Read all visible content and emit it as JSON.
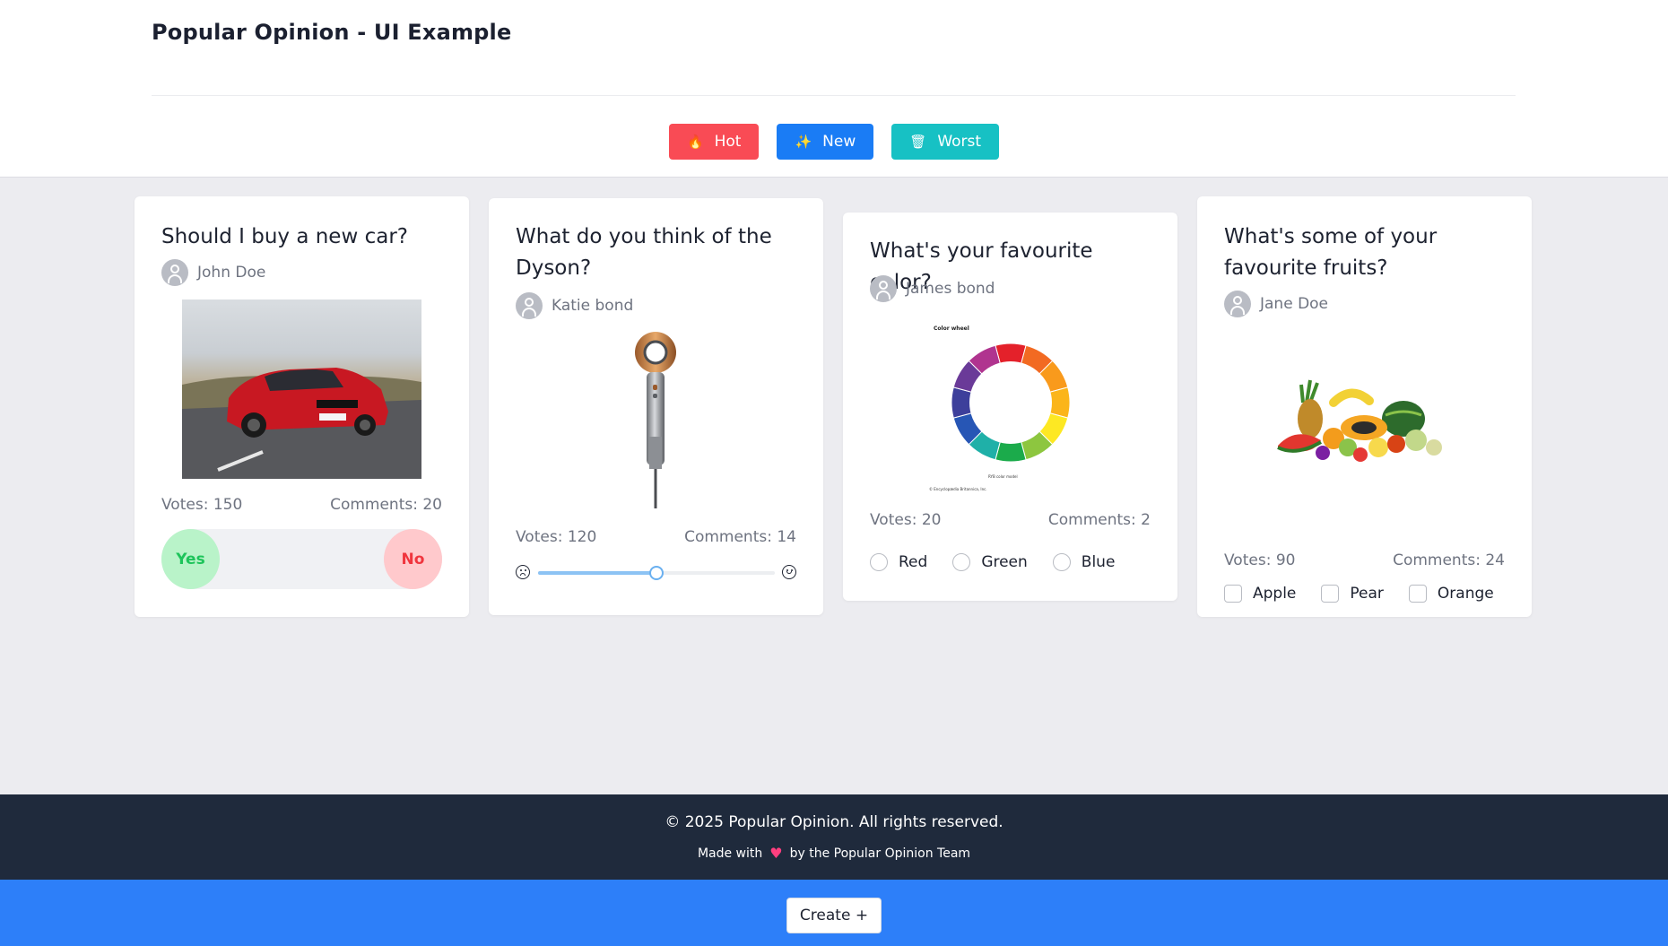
{
  "app": {
    "title": "Popular Opinion - UI Example"
  },
  "filters": [
    {
      "label": "Hot",
      "icon": "fire-icon",
      "color": "#f94b55"
    },
    {
      "label": "New",
      "icon": "sparkles-icon",
      "color": "#1a7cf5"
    },
    {
      "label": "Worst",
      "icon": "trash-icon",
      "color": "#17c1c4"
    }
  ],
  "cards": [
    {
      "title": "Should I buy a new car?",
      "author": "John Doe",
      "image": "car-photo",
      "votes": "Votes: 150",
      "comments": "Comments: 20",
      "input": {
        "type": "yes-no",
        "yes": "Yes",
        "no": "No"
      }
    },
    {
      "title": "What do you think of the Dyson?",
      "author": "Katie bond",
      "image": "hair-dryer-photo",
      "votes": "Votes: 120",
      "comments": "Comments: 14",
      "input": {
        "type": "slider",
        "value": 0.5
      }
    },
    {
      "title": "What's your favourite color?",
      "author": "James bond",
      "image": "color-wheel-image",
      "image_text": {
        "label": "Color wheel",
        "model": "RYB color model",
        "credit": "© Encyclopædia Britannica, Inc."
      },
      "votes": "Votes: 20",
      "comments": "Comments: 2",
      "input": {
        "type": "radio",
        "options": [
          "Red",
          "Green",
          "Blue"
        ]
      }
    },
    {
      "title": "What's some of your favourite fruits?",
      "author": "Jane Doe",
      "image": "fruits-photo",
      "votes": "Votes: 90",
      "comments": "Comments: 24",
      "input": {
        "type": "checkbox",
        "options": [
          "Apple",
          "Pear",
          "Orange"
        ]
      }
    }
  ],
  "footer": {
    "copyright": "© 2025 Popular Opinion. All rights reserved.",
    "made_with_prefix": "Made with",
    "made_with_suffix": "by the Popular Opinion Team"
  },
  "create": {
    "label": "Create +"
  },
  "colors": {
    "accent": "#2d7ff9",
    "footer_bg": "#1f2a3c",
    "yes": "#1dc45a",
    "no": "#f0353e"
  }
}
